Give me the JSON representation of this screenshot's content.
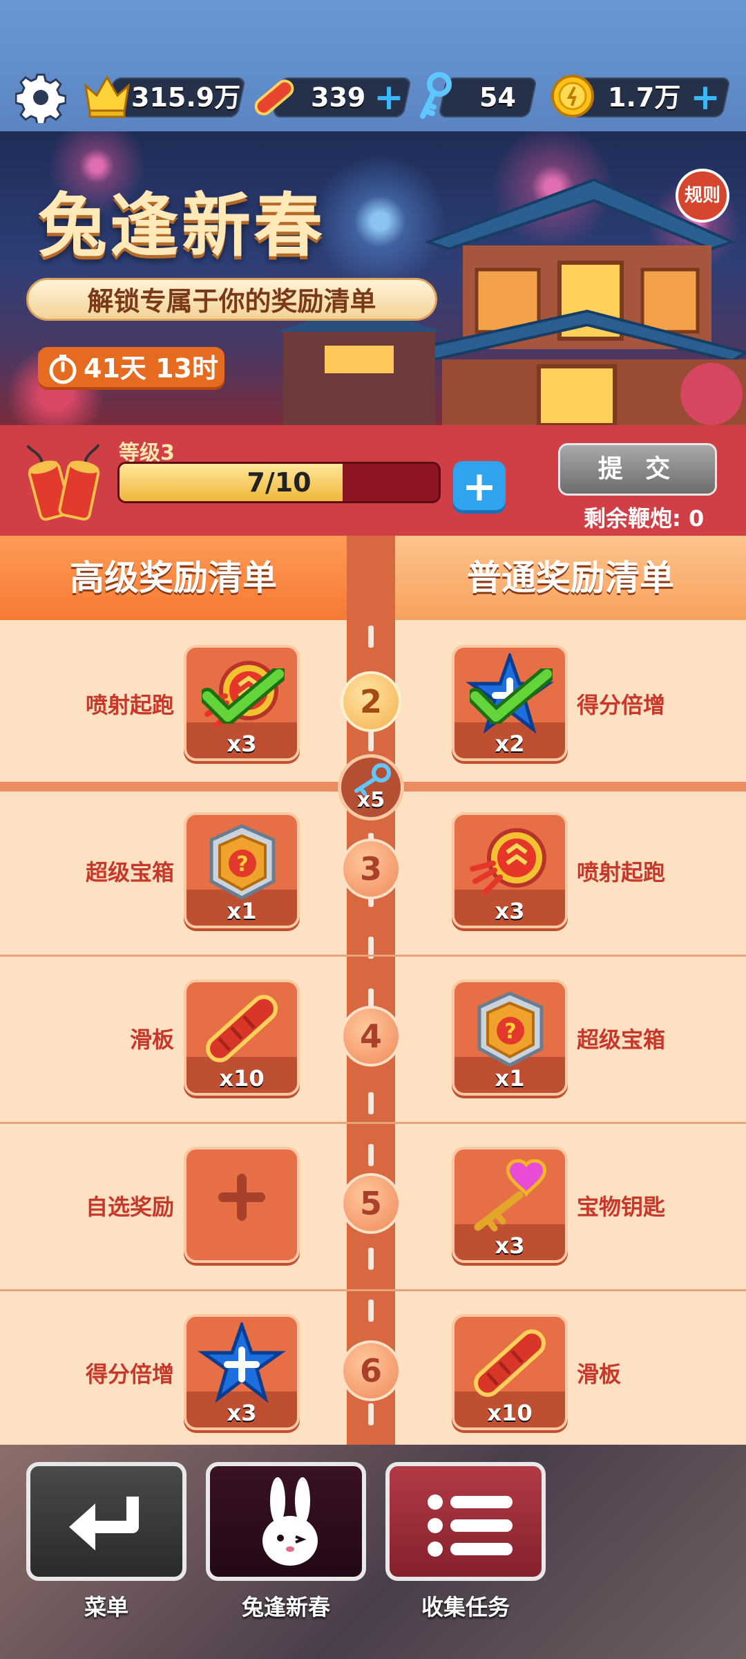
{
  "topbar": {
    "settings_icon": "gear-icon",
    "score": "315.9万",
    "boards": "339",
    "keys": "54",
    "coins": "1.7万"
  },
  "banner": {
    "title": "兔逢新春",
    "subtitle": "解锁专属于你的奖励清单",
    "timer": "41天 13时",
    "rules": "规则"
  },
  "level": {
    "label": "等级3",
    "progress_text": "7/10",
    "progress_fraction": 0.7,
    "submit": "提 交",
    "remaining": "剩余鞭炮: 0"
  },
  "list": {
    "premium_header": "高级奖励清单",
    "normal_header": "普通奖励清单",
    "key_milestone_count": "x5",
    "rows": [
      {
        "level": "2",
        "left": {
          "name": "喷射起跑",
          "count": "x3",
          "icon": "jetpack-start-icon",
          "claimed": true
        },
        "right": {
          "name": "得分倍增",
          "count": "x2",
          "icon": "score-multiplier-icon",
          "claimed": true
        }
      },
      {
        "level": "3",
        "left": {
          "name": "超级宝箱",
          "count": "x1",
          "icon": "super-box-icon"
        },
        "right": {
          "name": "喷射起跑",
          "count": "x3",
          "icon": "jetpack-start-icon"
        }
      },
      {
        "level": "4",
        "left": {
          "name": "滑板",
          "count": "x10",
          "icon": "hoverboard-icon"
        },
        "right": {
          "name": "超级宝箱",
          "count": "x1",
          "icon": "super-box-icon"
        }
      },
      {
        "level": "5",
        "left": {
          "name": "自选奖励",
          "count": "",
          "icon": "plus-icon"
        },
        "right": {
          "name": "宝物钥匙",
          "count": "x3",
          "icon": "treasure-key-icon"
        }
      },
      {
        "level": "6",
        "left": {
          "name": "得分倍增",
          "count": "x3",
          "icon": "score-multiplier-icon"
        },
        "right": {
          "name": "滑板",
          "count": "x10",
          "icon": "hoverboard-icon"
        }
      }
    ]
  },
  "nav": {
    "menu": "菜单",
    "event": "兔逢新春",
    "tasks": "收集任务"
  }
}
